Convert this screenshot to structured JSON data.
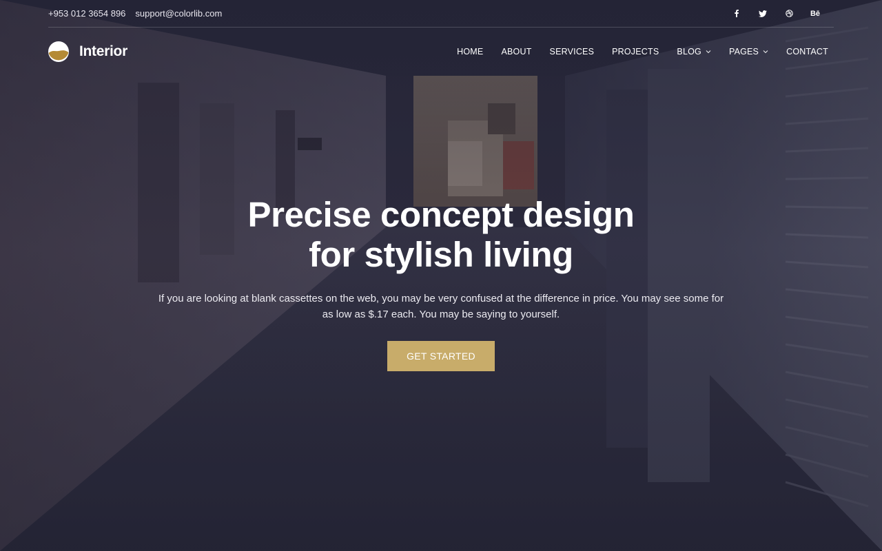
{
  "topbar": {
    "phone": "+953 012 3654 896",
    "email": "support@colorlib.com",
    "social": [
      {
        "name": "facebook-icon",
        "label": "f"
      },
      {
        "name": "twitter-icon",
        "label": ""
      },
      {
        "name": "dribbble-icon",
        "label": ""
      },
      {
        "name": "behance-icon",
        "label": "Bē"
      }
    ]
  },
  "brand": {
    "name": "Interior",
    "logo_colors": {
      "top": "#ffffff",
      "bottom": "#b48a35"
    }
  },
  "nav": {
    "items": [
      {
        "label": "HOME",
        "has_dropdown": false
      },
      {
        "label": "ABOUT",
        "has_dropdown": false
      },
      {
        "label": "SERVICES",
        "has_dropdown": false
      },
      {
        "label": "PROJECTS",
        "has_dropdown": false
      },
      {
        "label": "BLOG",
        "has_dropdown": true
      },
      {
        "label": "PAGES",
        "has_dropdown": true
      },
      {
        "label": "CONTACT",
        "has_dropdown": false
      }
    ],
    "dropdown_icon": "chevron-down-icon"
  },
  "hero": {
    "title_line1": "Precise concept design",
    "title_line2": "for stylish living",
    "text": "If you are looking at blank cassettes on the web, you may be very confused at the difference in price. You may see some for as low as $.17 each. You may be saying to yourself.",
    "cta_label": "GET STARTED"
  },
  "colors": {
    "accent": "#c8ac6a",
    "overlay": "#222134"
  }
}
